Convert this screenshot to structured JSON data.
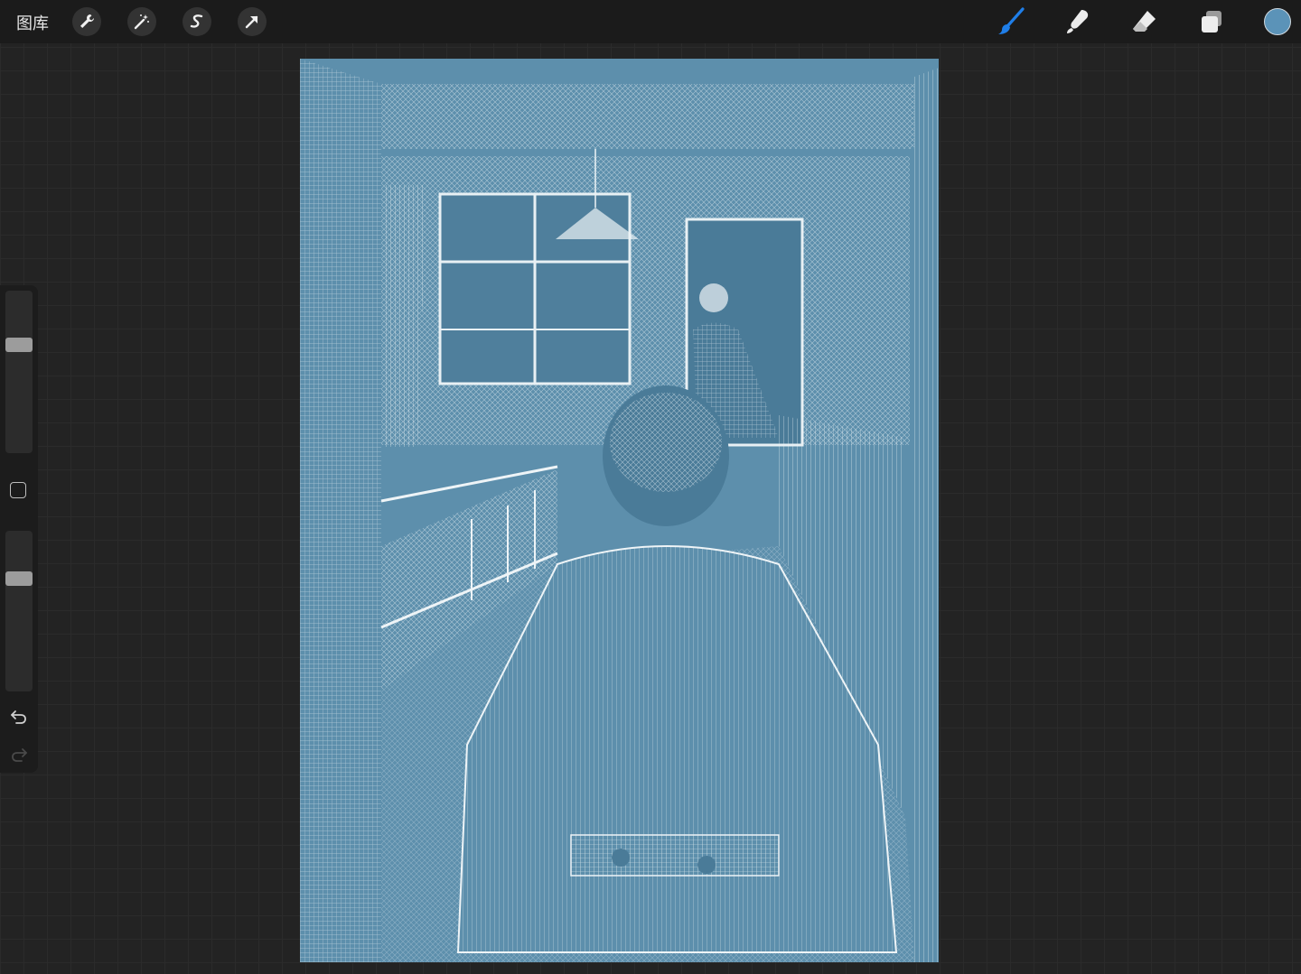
{
  "topbar": {
    "gallery_label": "图库",
    "left_tools": [
      "wrench-icon",
      "magic-wand-icon",
      "selection-s-icon",
      "transform-arrow-icon"
    ],
    "right_tools": [
      "brush-icon",
      "smudge-icon",
      "eraser-icon",
      "layers-icon"
    ],
    "accent_color": "#1f7ee8",
    "current_color": "#5b93b8"
  },
  "sidebar": {
    "brush_size": 0.68,
    "opacity": 0.72
  },
  "canvas": {
    "ink_color": "#5d8fac",
    "paper_color": "#eef4f7"
  }
}
